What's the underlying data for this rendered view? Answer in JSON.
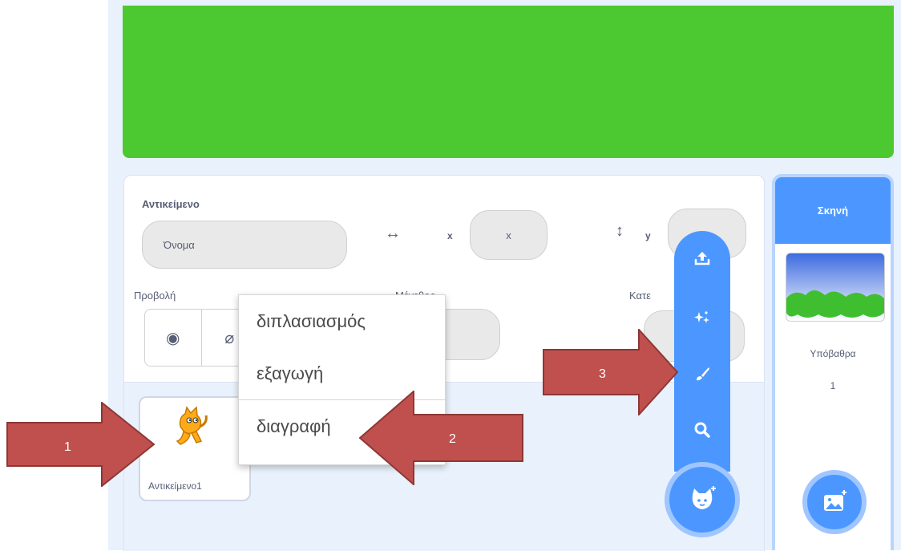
{
  "sprite_info": {
    "heading": "Αντικείμενο",
    "name_placeholder": "Όνομα",
    "x_label": "x",
    "x_value": "x",
    "y_label": "y",
    "show_label": "Προβολή",
    "size_label": "Μέγεθος",
    "direction_label": "Κατε"
  },
  "sprite_list": {
    "items": [
      {
        "name": "Αντικείμενο1"
      }
    ]
  },
  "context_menu": {
    "items": [
      {
        "label": "διπλασιασμός"
      },
      {
        "label": "εξαγωγή"
      },
      {
        "label": "διαγραφή"
      }
    ]
  },
  "sprite_fab_menu": {
    "items": [
      "upload-icon",
      "surprise-icon",
      "paint-icon",
      "search-icon"
    ],
    "main": "choose-sprite-icon"
  },
  "stage_panel": {
    "title": "Σκηνή",
    "backdrops_label": "Υπόβαθρα",
    "backdrops_count": "1"
  },
  "annotations": [
    {
      "label": "1"
    },
    {
      "label": "2"
    },
    {
      "label": "3"
    }
  ],
  "colors": {
    "stage_green": "#4cc930",
    "scratch_blue": "#4c97ff",
    "arrow_red": "#c0504d"
  }
}
